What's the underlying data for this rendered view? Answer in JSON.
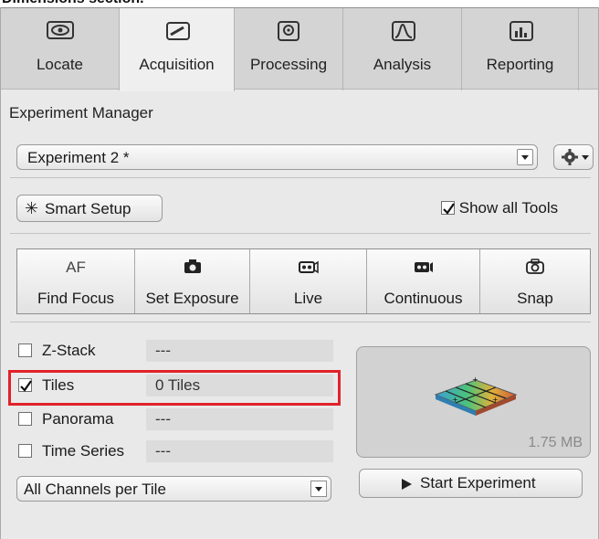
{
  "clipped_caption": "Dimensions section.",
  "tabs": [
    {
      "label": "Locate",
      "icon": "eye-icon"
    },
    {
      "label": "Acquisition",
      "icon": "microscope-icon",
      "active": true
    },
    {
      "label": "Processing",
      "icon": "gear-processing-icon"
    },
    {
      "label": "Analysis",
      "icon": "curve-icon"
    },
    {
      "label": "Reporting",
      "icon": "chart-icon"
    }
  ],
  "experiment_manager": {
    "label": "Experiment Manager",
    "selected": "Experiment 2 *"
  },
  "smart_setup": {
    "label": "Smart Setup"
  },
  "show_all_tools": {
    "label": "Show all Tools",
    "checked": true
  },
  "actions": [
    {
      "top": "AF",
      "label": "Find Focus"
    },
    {
      "label": "Set Exposure",
      "icon": "camera-icon"
    },
    {
      "label": "Live",
      "icon": "live-camera-icon"
    },
    {
      "label": "Continuous",
      "icon": "video-camera-icon"
    },
    {
      "label": "Snap",
      "icon": "snap-camera-icon"
    }
  ],
  "dimensions": [
    {
      "label": "Z-Stack",
      "value": "---",
      "checked": false
    },
    {
      "label": "Tiles",
      "value": "0 Tiles",
      "checked": true
    },
    {
      "label": "Panorama",
      "value": "---",
      "checked": false
    },
    {
      "label": "Time Series",
      "value": "---",
      "checked": false
    }
  ],
  "channel_mode": {
    "selected": "All Channels per Tile"
  },
  "preview": {
    "size": "1.75 MB"
  },
  "start_experiment": {
    "label": "Start Experiment"
  },
  "colors": {
    "highlight": "#e0222a",
    "panel": "#e9e9e9",
    "tabbar": "#d4d4d4"
  }
}
